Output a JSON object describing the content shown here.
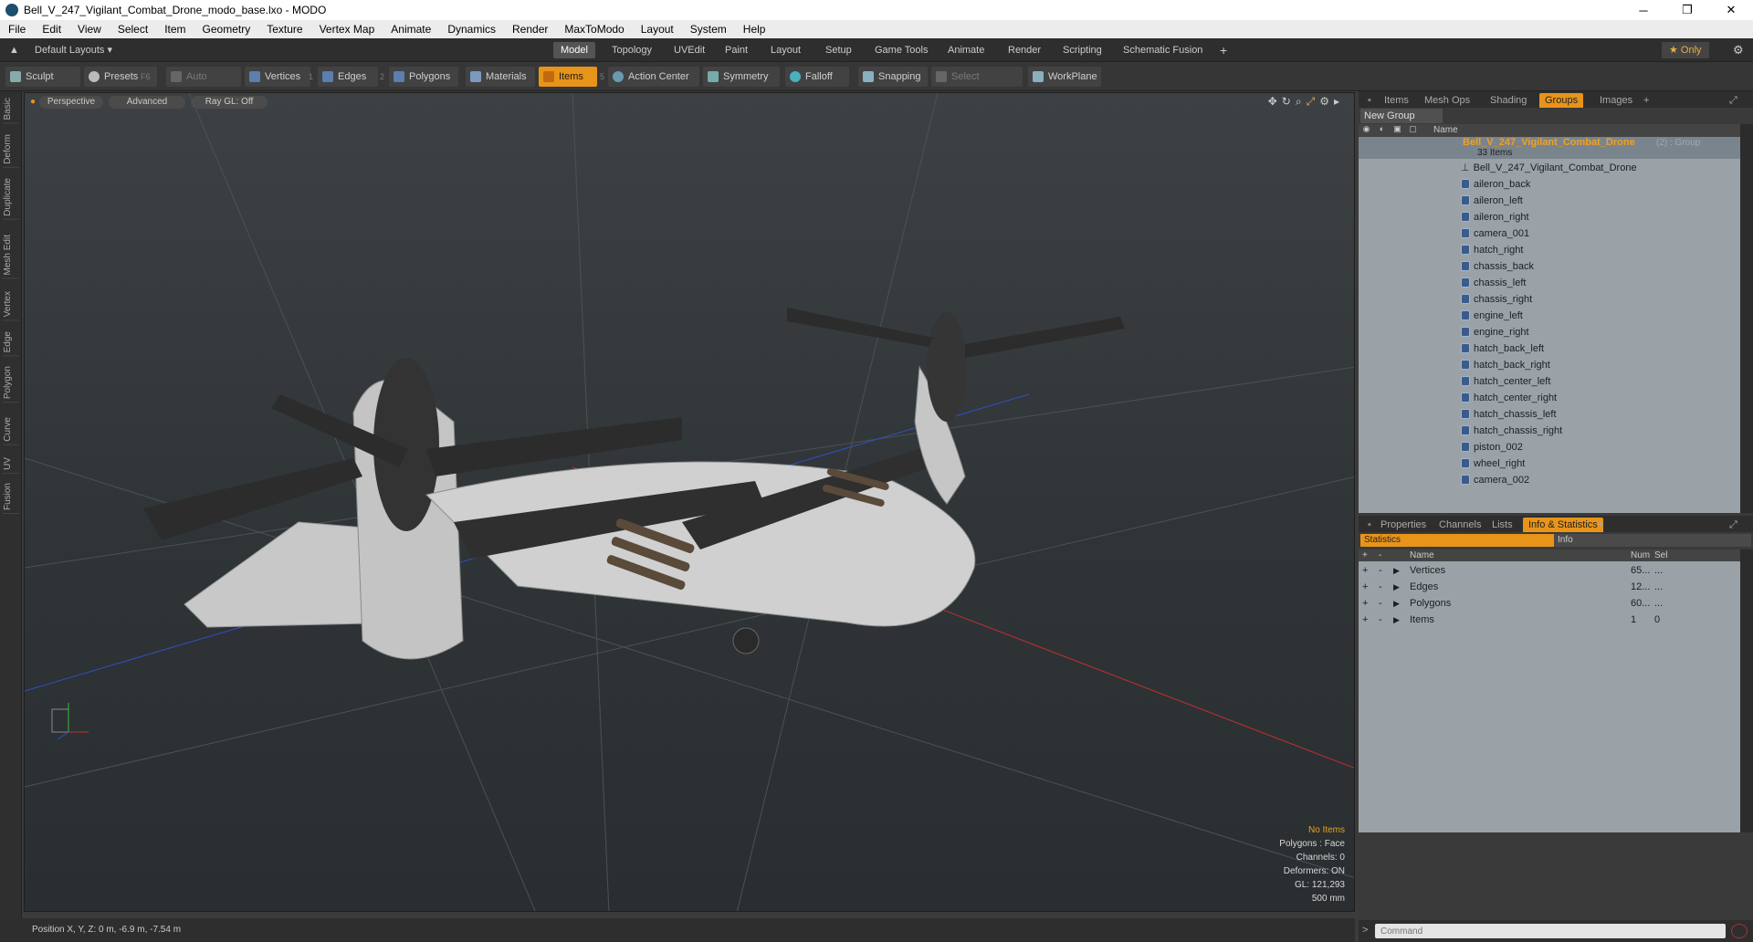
{
  "window": {
    "title": "Bell_V_247_Vigilant_Combat_Drone_modo_base.lxo - MODO",
    "minimize": "─",
    "maximize": "❐",
    "close": "✕"
  },
  "menu": [
    "File",
    "Edit",
    "View",
    "Select",
    "Item",
    "Geometry",
    "Texture",
    "Vertex Map",
    "Animate",
    "Dynamics",
    "Render",
    "MaxToModo",
    "Layout",
    "System",
    "Help"
  ],
  "layoutbar": {
    "layouts_label": "Default Layouts ▾",
    "tabs": [
      "Model",
      "Topology",
      "UVEdit",
      "Paint",
      "Layout",
      "Setup",
      "Game Tools",
      "Animate",
      "Render",
      "Scripting",
      "Schematic Fusion"
    ],
    "active": "Model",
    "plus": "+",
    "only_label": "★  Only",
    "gear": "⚙"
  },
  "toolbar": {
    "sculpt": "Sculpt",
    "presets": "Presets",
    "presets_key": "F6",
    "auto_select": "Auto Select",
    "vertices": "Vertices",
    "vertices_count": "1",
    "edges": "Edges",
    "edges_count": "2",
    "polygons": "Polygons",
    "materials": "Materials",
    "items": "Items",
    "items_count": "5",
    "action_center": "Action Center",
    "symmetry": "Symmetry",
    "falloff": "Falloff",
    "snapping": "Snapping",
    "select_through": "Select Through",
    "workplane": "WorkPlane"
  },
  "left_tabs": [
    "Basic",
    "Deform",
    "Duplicate",
    "Mesh Edit",
    "Vertex",
    "Edge",
    "Polygon",
    "Curve",
    "UV",
    "Fusion"
  ],
  "viewport": {
    "perspective": "Perspective",
    "advanced": "Advanced",
    "raygl": "Ray GL: Off",
    "info": {
      "no_items": "No Items",
      "polygons": "Polygons : Face",
      "channels": "Channels: 0",
      "deformers": "Deformers: ON",
      "gl": "GL: 121,293",
      "scale": "500 mm"
    }
  },
  "status": {
    "position": "Position X, Y, Z:   0 m, -6.9 m, -7.54 m"
  },
  "groups_panel": {
    "tabs": [
      "Items",
      "Mesh Ops",
      "Shading",
      "Groups",
      "Images"
    ],
    "active": "Groups",
    "new_group": "New Group",
    "name_header": "Name",
    "group_name": "Bell_V_247_Vigilant_Combat_Drone",
    "group_suffix": "(2) : Group",
    "group_count": "33 Items",
    "mesh_item": "Bell_V_247_Vigilant_Combat_Drone",
    "items": [
      "aileron_back",
      "aileron_left",
      "aileron_right",
      "camera_001",
      "hatch_right",
      "chassis_back",
      "chassis_left",
      "chassis_right",
      "engine_left",
      "engine_right",
      "hatch_back_left",
      "hatch_back_right",
      "hatch_center_left",
      "hatch_center_right",
      "hatch_chassis_left",
      "hatch_chassis_right",
      "piston_002",
      "wheel_right",
      "camera_002"
    ]
  },
  "stats_panel": {
    "tabs": [
      "Properties",
      "Channels",
      "Lists",
      "Info & Statistics"
    ],
    "active": "Info & Statistics",
    "sub_tabs": [
      "Statistics",
      "Info"
    ],
    "headers": {
      "name": "Name",
      "num": "Num",
      "sel": "Sel"
    },
    "rows": [
      {
        "name": "Vertices",
        "num": "65...",
        "sel": "..."
      },
      {
        "name": "Edges",
        "num": "12...",
        "sel": "..."
      },
      {
        "name": "Polygons",
        "num": "60...",
        "sel": "..."
      },
      {
        "name": "Items",
        "num": "1",
        "sel": "0"
      }
    ],
    "command_placeholder": "Command"
  }
}
